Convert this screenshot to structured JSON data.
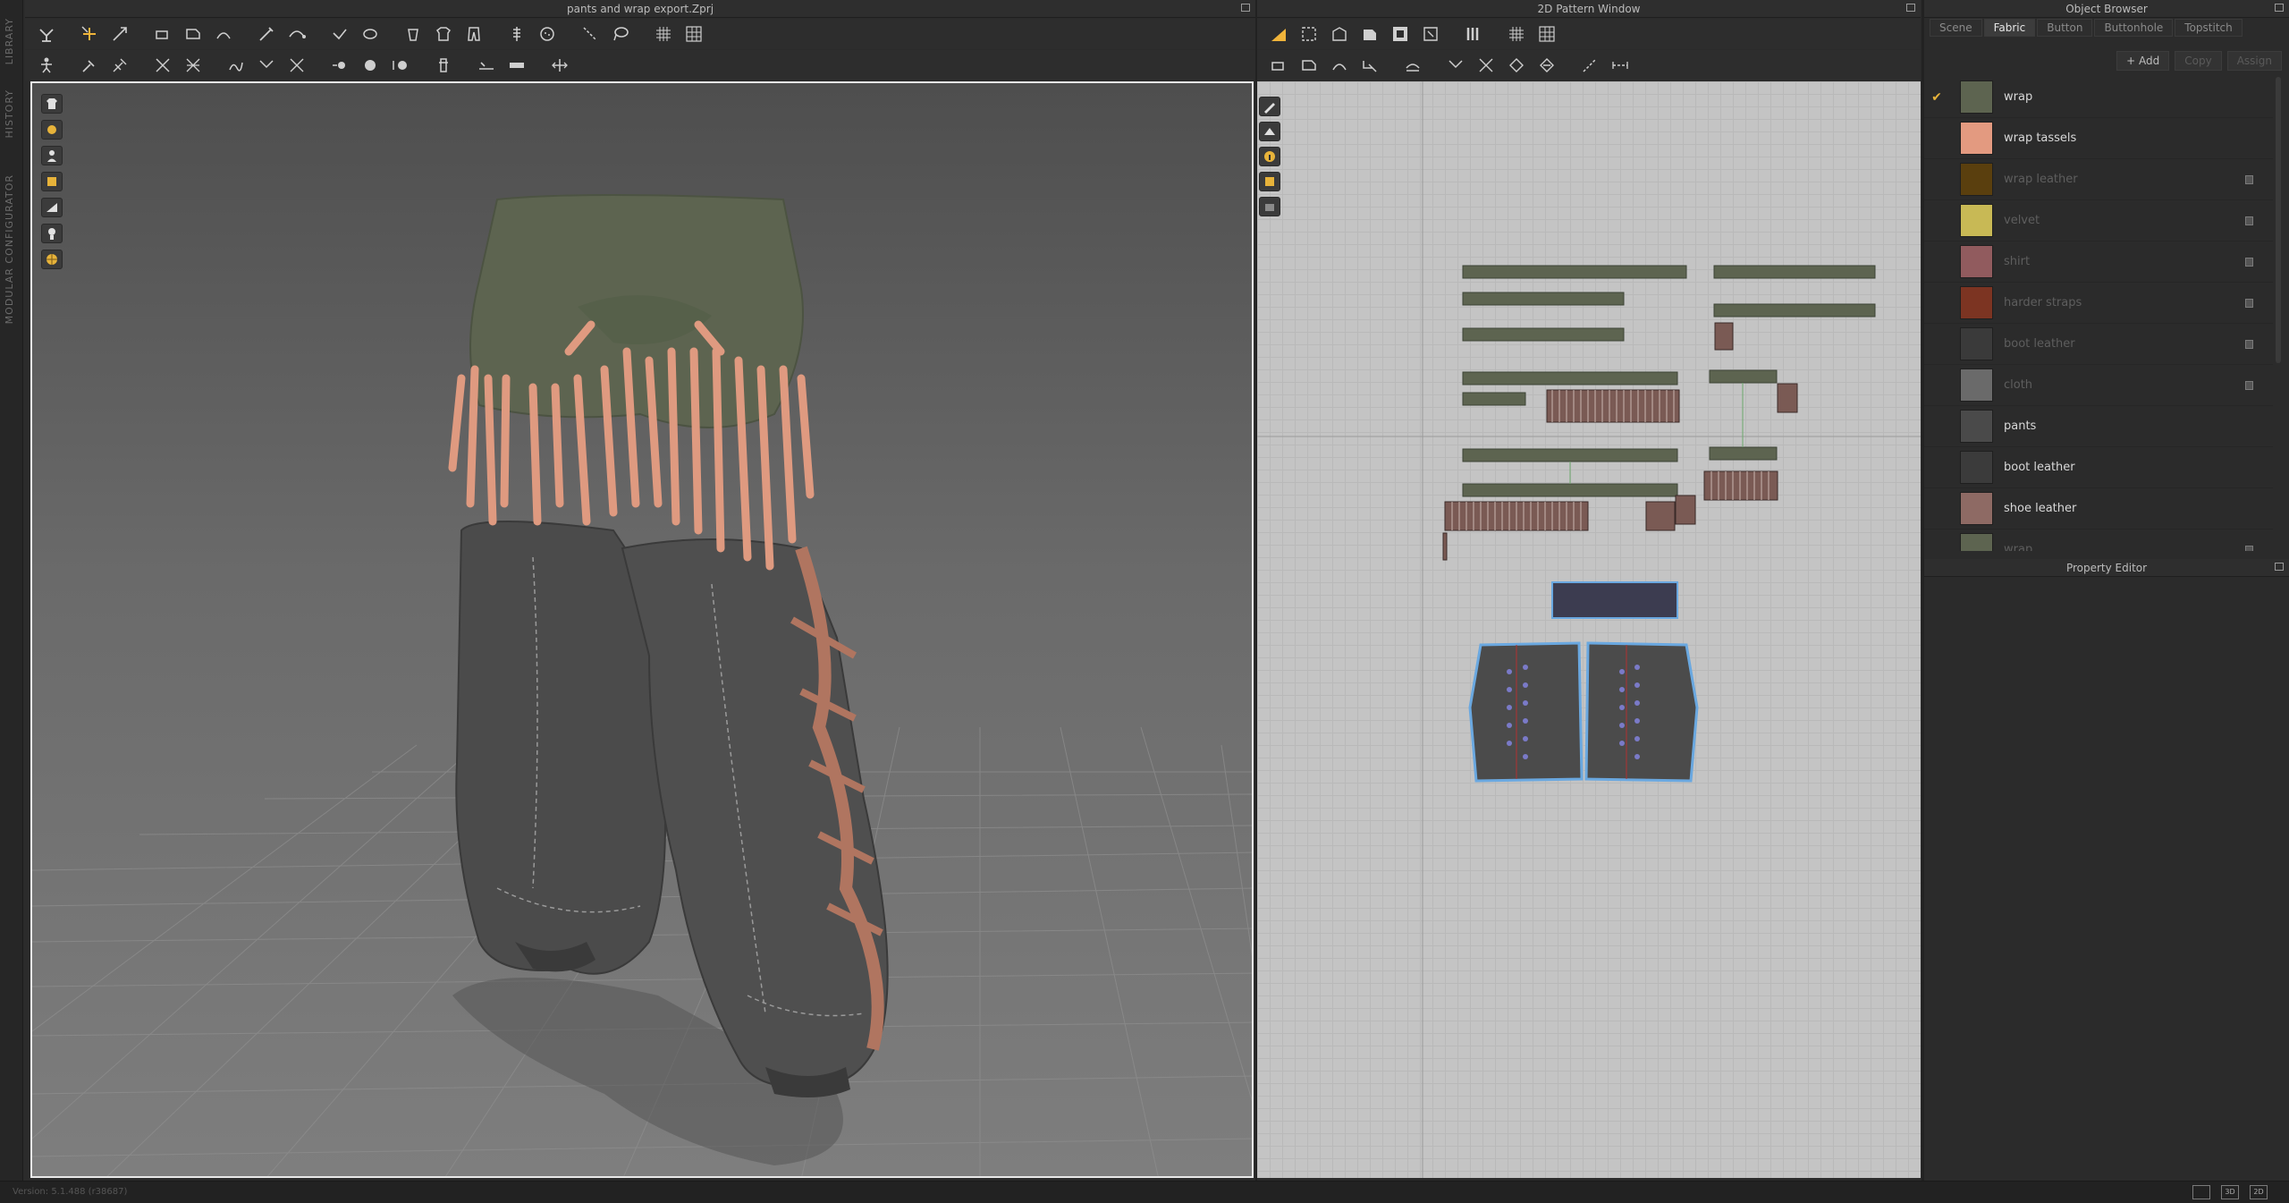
{
  "side_rail": {
    "labels": [
      "LIBRARY",
      "HISTORY",
      "MODULAR CONFIGURATOR"
    ]
  },
  "viewport3d": {
    "title": "pants and wrap export.Zprj"
  },
  "pattern2d": {
    "title": "2D Pattern Window"
  },
  "object_browser": {
    "title": "Object Browser",
    "tabs": [
      "Scene",
      "Fabric",
      "Button",
      "Buttonhole",
      "Topstitch"
    ],
    "active_tab": "Fabric",
    "actions": {
      "add": "+ Add",
      "copy": "Copy",
      "assign": "Assign"
    },
    "fabrics": [
      {
        "name": "wrap",
        "color": "#5d6450",
        "checked": true,
        "dim": false,
        "locked": false
      },
      {
        "name": "wrap tassels",
        "color": "#e39a80",
        "checked": false,
        "dim": false,
        "locked": false
      },
      {
        "name": "wrap leather",
        "color": "#5a3f0e",
        "checked": false,
        "dim": true,
        "locked": true
      },
      {
        "name": "velvet",
        "color": "#c8b955",
        "checked": false,
        "dim": true,
        "locked": true
      },
      {
        "name": "shirt",
        "color": "#915b5e",
        "checked": false,
        "dim": true,
        "locked": true
      },
      {
        "name": "harder straps",
        "color": "#7c3422",
        "checked": false,
        "dim": true,
        "locked": true
      },
      {
        "name": "boot leather",
        "color": "#3a3a3a",
        "checked": false,
        "dim": true,
        "locked": true
      },
      {
        "name": "cloth",
        "color": "#6a6a6a",
        "checked": false,
        "dim": true,
        "locked": true
      },
      {
        "name": "pants",
        "color": "#4a4a4a",
        "checked": false,
        "dim": false,
        "locked": false
      },
      {
        "name": "boot leather",
        "color": "#3b3b3b",
        "checked": false,
        "dim": false,
        "locked": false
      },
      {
        "name": "shoe leather",
        "color": "#8e6a64",
        "checked": false,
        "dim": false,
        "locked": false
      },
      {
        "name": "wrap",
        "color": "#5d6450",
        "checked": false,
        "dim": true,
        "locked": true
      }
    ]
  },
  "property_editor": {
    "title": "Property Editor"
  },
  "status_bar": {
    "text": "Version: 5.1.488 (r38687)",
    "view_buttons": [
      "",
      "3D",
      "2D"
    ]
  }
}
